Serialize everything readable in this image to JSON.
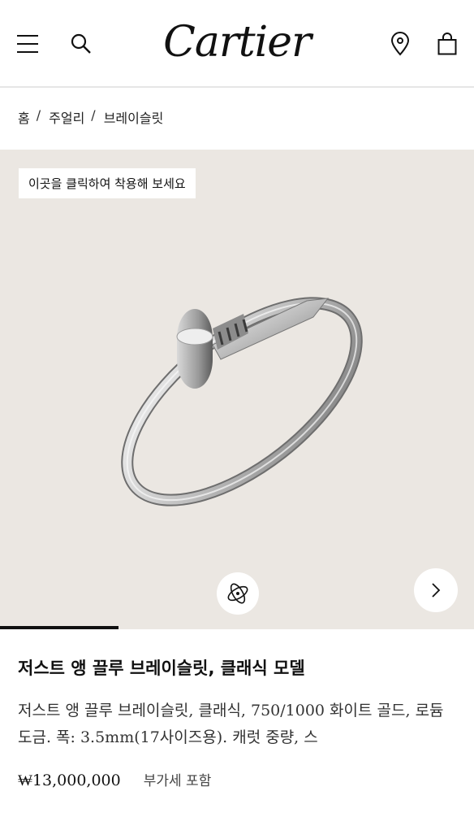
{
  "header": {
    "logo": "Cartier",
    "icons": [
      "menu-icon",
      "search-icon",
      "location-pin-icon",
      "shopping-bag-icon"
    ]
  },
  "breadcrumb": {
    "items": [
      "홈",
      "주얼리",
      "브레이슬릿"
    ],
    "separator": "/"
  },
  "gallery": {
    "try_on_label": "이곳을 클릭하여 착용해 보세요",
    "background_color": "#ebe7e2",
    "icons": [
      "rotate-360-icon",
      "chevron-right-icon"
    ],
    "progress": 0.25
  },
  "product": {
    "title": "저스트 앵 끌루 브레이슬릿, 클래식 모델",
    "description": "저스트 앵 끌루 브레이슬릿, 클래식, 750/1000 화이트 골드, 로듐 도금. 폭: 3.5mm(17사이즈용). 캐럿 중량, 스",
    "price": "₩13,000,000",
    "tax_note": "부가세 포함"
  }
}
